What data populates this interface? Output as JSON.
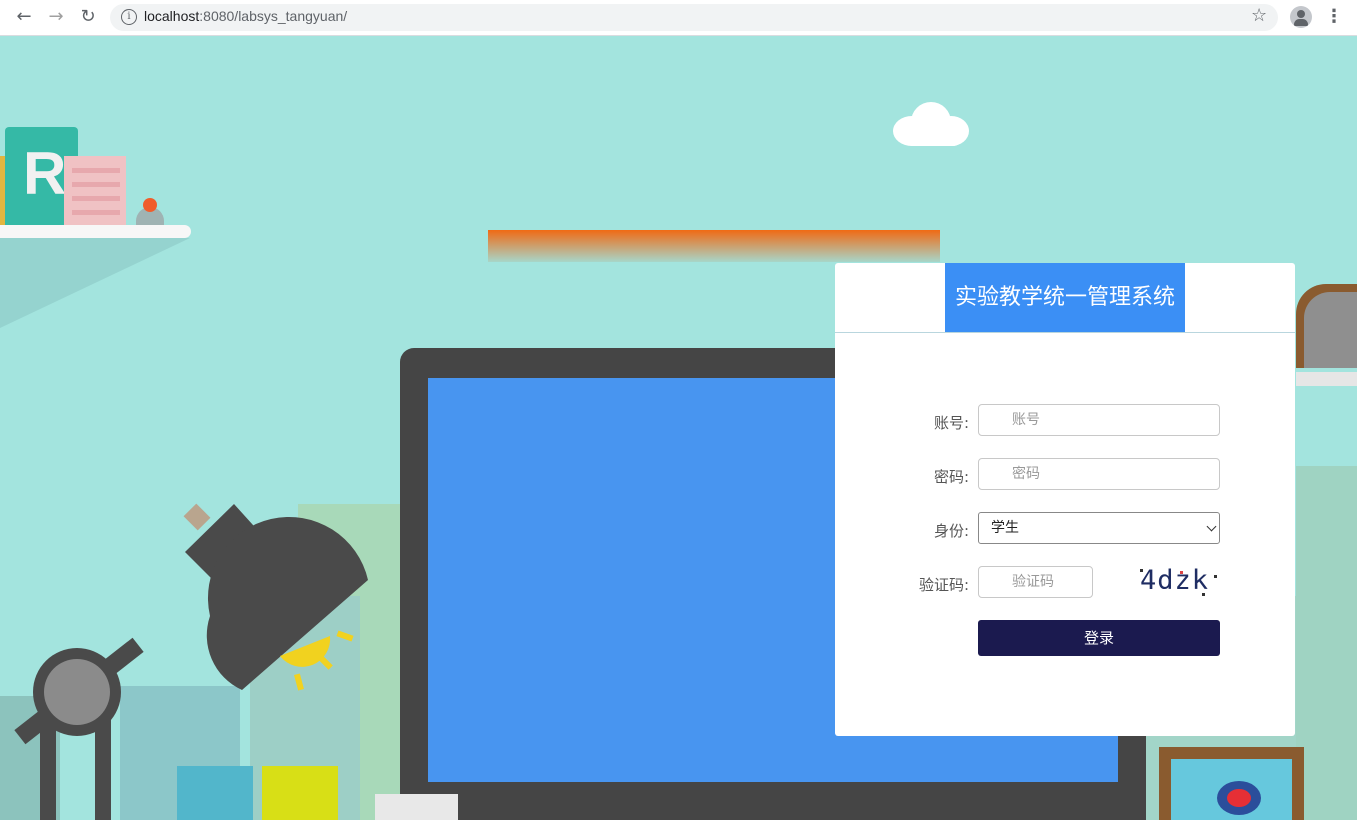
{
  "browser": {
    "url_host": "localhost",
    "url_rest": ":8080/labsys_tangyuan/"
  },
  "scene": {
    "book_letter": "R"
  },
  "login": {
    "title": "实验教学统一管理系统",
    "account_label": "账号:",
    "account_placeholder": "账号",
    "password_label": "密码:",
    "password_placeholder": "密码",
    "identity_label": "身份:",
    "identity_selected": "学生",
    "captcha_label": "验证码:",
    "captcha_placeholder": "验证码",
    "captcha_text": "4dzk",
    "login_button": "登录"
  },
  "colors": {
    "background": "#a3e4de",
    "title_bg": "#3b8ff5",
    "login_button_bg": "#1b1a4f",
    "monitor_screen": "#4895f0"
  }
}
